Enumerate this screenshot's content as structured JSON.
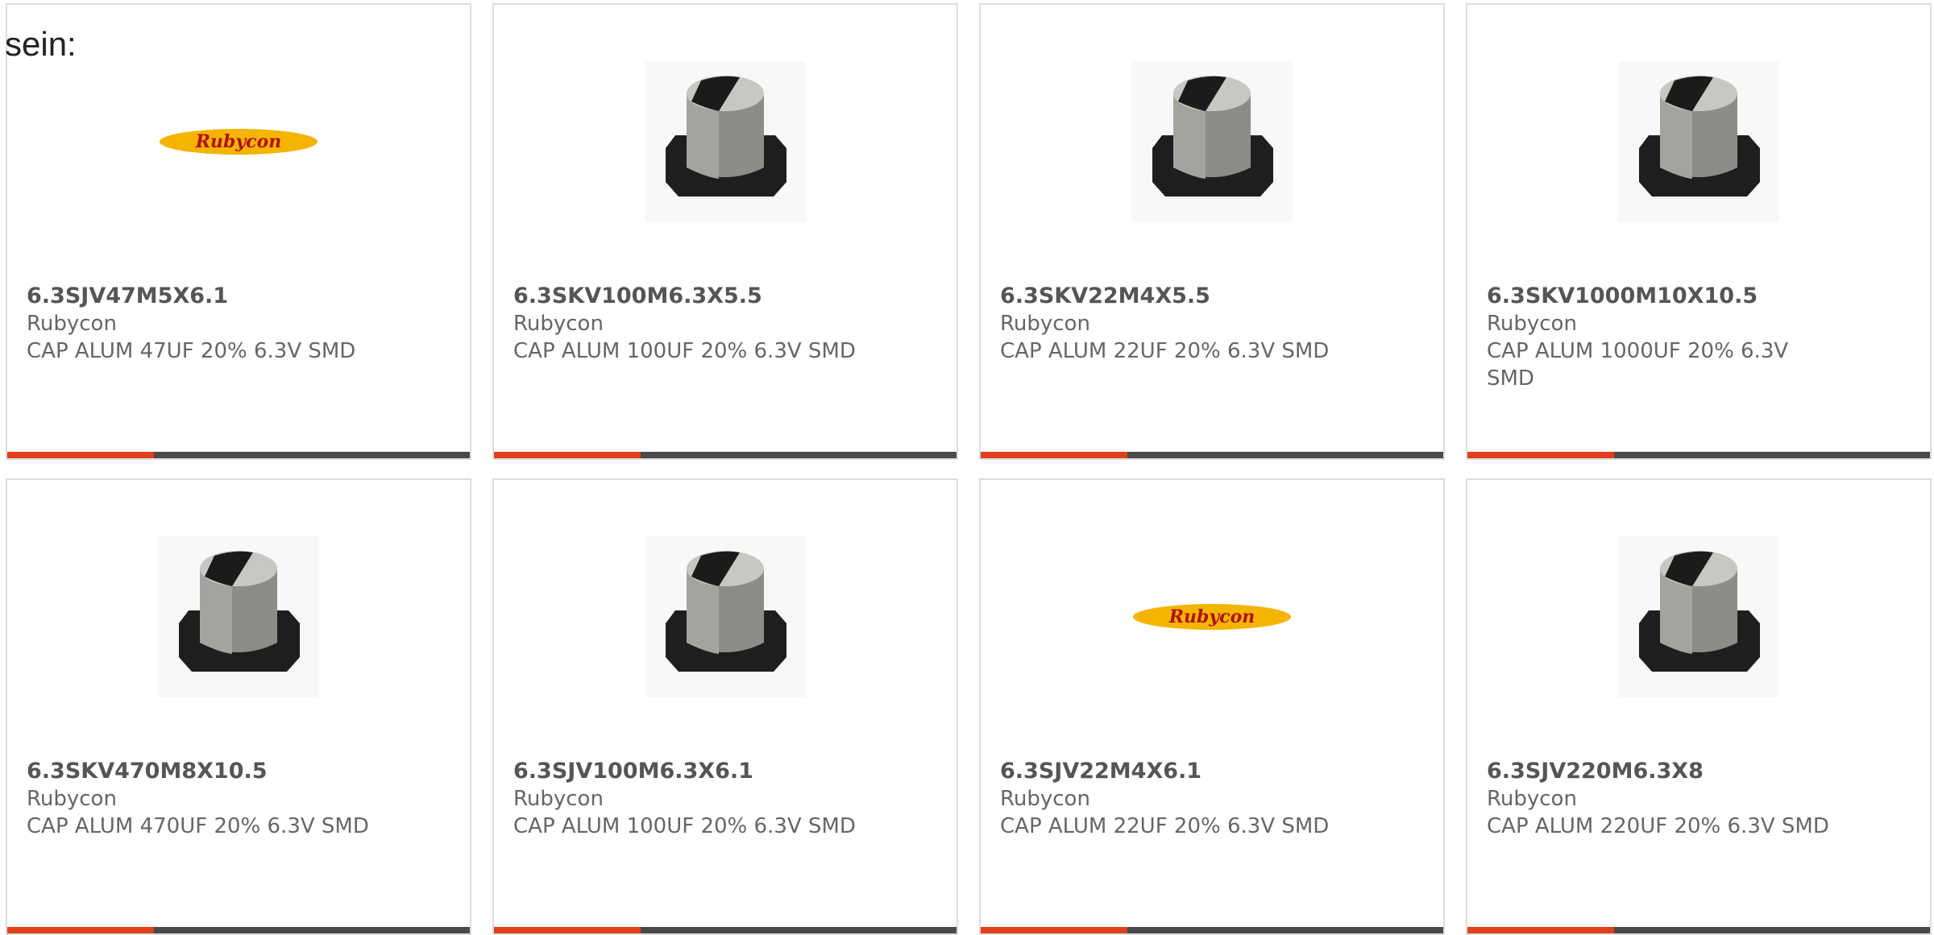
{
  "intro": {
    "text": "sein:"
  },
  "colors": {
    "accent": "#e0401a",
    "bar": "#4a4a4a",
    "border": "#dddddd",
    "text_primary": "#555555",
    "text_secondary": "#666666",
    "logo_yellow": "#f4b400",
    "logo_text": "#b0121b"
  },
  "products": [
    {
      "image": "rubycon-logo",
      "logo_text": "Rubycon",
      "part_number": "6.3SJV47M5X6.1",
      "manufacturer": "Rubycon",
      "description": "CAP ALUM 47UF 20% 6.3V SMD"
    },
    {
      "image": "smd-capacitor-icon",
      "part_number": "6.3SKV100M6.3X5.5",
      "manufacturer": "Rubycon",
      "description": "CAP ALUM 100UF 20% 6.3V SMD"
    },
    {
      "image": "smd-capacitor-icon",
      "part_number": "6.3SKV22M4X5.5",
      "manufacturer": "Rubycon",
      "description": "CAP ALUM 22UF 20% 6.3V SMD"
    },
    {
      "image": "smd-capacitor-icon",
      "part_number": "6.3SKV1000M10X10.5",
      "manufacturer": "Rubycon",
      "description": "CAP ALUM 1000UF 20% 6.3V SMD"
    },
    {
      "image": "smd-capacitor-icon",
      "part_number": "6.3SKV470M8X10.5",
      "manufacturer": "Rubycon",
      "description": "CAP ALUM 470UF 20% 6.3V SMD"
    },
    {
      "image": "smd-capacitor-icon",
      "part_number": "6.3SJV100M6.3X6.1",
      "manufacturer": "Rubycon",
      "description": "CAP ALUM 100UF 20% 6.3V SMD"
    },
    {
      "image": "rubycon-logo",
      "logo_text": "Rubycon",
      "part_number": "6.3SJV22M4X6.1",
      "manufacturer": "Rubycon",
      "description": "CAP ALUM 22UF 20% 6.3V SMD"
    },
    {
      "image": "smd-capacitor-icon",
      "part_number": "6.3SJV220M6.3X8",
      "manufacturer": "Rubycon",
      "description": "CAP ALUM 220UF 20% 6.3V SMD"
    }
  ]
}
